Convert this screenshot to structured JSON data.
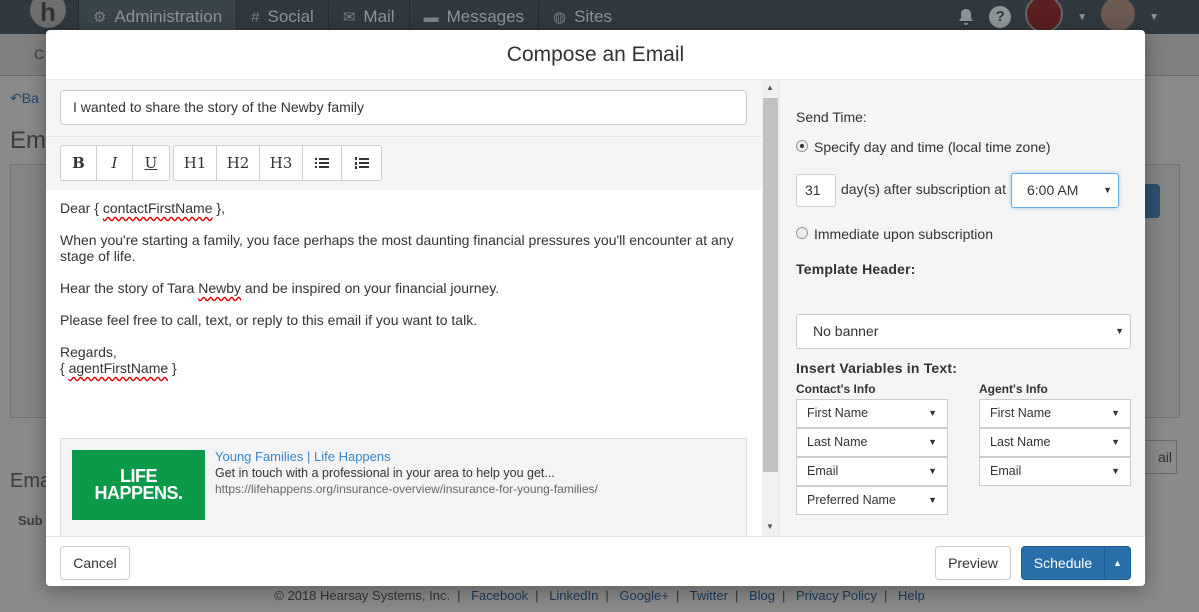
{
  "nav": {
    "logo": "h",
    "tabs": [
      {
        "label": "Administration",
        "icon": "gear-icon"
      },
      {
        "label": "Social",
        "icon": "hash-icon"
      },
      {
        "label": "Mail",
        "icon": "envelope-icon"
      },
      {
        "label": "Messages",
        "icon": "chat-icon"
      },
      {
        "label": "Sites",
        "icon": "globe-icon"
      }
    ],
    "help": "?"
  },
  "background": {
    "subnav_fragment": "C",
    "back_fragment": "Ba",
    "heading_fragment": "Em",
    "section_fragment": "Ema",
    "column_fragment": "Sub",
    "button_fragment": "ail"
  },
  "modal": {
    "title": "Compose an Email",
    "subject": "I wanted to share the story of the Newby family",
    "toolbar": {
      "bold": "B",
      "italic": "I",
      "underline": "U",
      "h1": "H1",
      "h2": "H2",
      "h3": "H3"
    },
    "body": {
      "greeting_prefix": "Dear { ",
      "greeting_var": "contactFirstName",
      "greeting_suffix": " },",
      "para1": "When you're starting a family, you face perhaps the most daunting financial pressures you'll encounter at any stage of life.",
      "para2_prefix": "Hear the story of Tara ",
      "para2_name": "Newby",
      "para2_suffix": " and be inspired on your financial journey.",
      "para3": "Please feel free to call, text, or reply to this email if you want to talk.",
      "closing": "Regards,",
      "sign_prefix": "{ ",
      "sign_var": "agentFirstName",
      "sign_suffix": " }"
    },
    "link_preview": {
      "logo_line1": "LIFE",
      "logo_line2": "HAPPENS.",
      "title": "Young Families | Life Happens",
      "description": "Get in touch with a professional in your area to help you get...",
      "url": "https://lifehappens.org/insurance-overview/insurance-for-young-families/"
    },
    "settings": {
      "send_time_label": "Send Time:",
      "option_specify": "Specify day and time (local time zone)",
      "days_value": "31",
      "days_suffix": "day(s) after subscription at",
      "time_value": "6:00 AM",
      "option_immediate": "Immediate upon subscription",
      "template_header_label": "Template Header:",
      "banner_value": "No banner",
      "insert_variables_label": "Insert Variables in Text:",
      "contact_info_label": "Contact's Info",
      "agent_info_label": "Agent's Info",
      "contact_vars": [
        "First Name",
        "Last Name",
        "Email",
        "Preferred Name"
      ],
      "agent_vars": [
        "First Name",
        "Last Name",
        "Email"
      ]
    },
    "footer": {
      "cancel": "Cancel",
      "preview": "Preview",
      "schedule": "Schedule"
    }
  },
  "footer": {
    "copyright": "© 2018 Hearsay Systems, Inc.",
    "links": [
      "Facebook",
      "LinkedIn",
      "Google+",
      "Twitter",
      "Blog",
      "Privacy Policy",
      "Help"
    ]
  }
}
